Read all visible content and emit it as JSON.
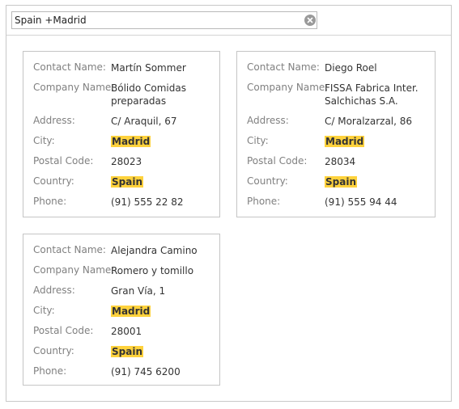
{
  "search": {
    "value": "Spain +Madrid"
  },
  "colors": {
    "highlight": "#ffd23c",
    "border": "#c5c5c5",
    "label": "#808080"
  },
  "labels": {
    "contact_name": "Contact Name:",
    "company_name": "Company Name:",
    "address": "Address:",
    "city": "City:",
    "postal_code": "Postal Code:",
    "country": "Country:",
    "phone": "Phone:"
  },
  "cards": [
    {
      "contact_name": "Martín Sommer",
      "company_line1": "Bólido Comidas",
      "company_line2": "preparadas",
      "address": "C/ Araquil, 67",
      "city": "Madrid",
      "postal_code": "28023",
      "country": "Spain",
      "phone": "(91) 555 22 82"
    },
    {
      "contact_name": "Diego Roel",
      "company_line1": "FISSA Fabrica Inter.",
      "company_line2": "Salchichas S.A.",
      "address": "C/ Moralzarzal, 86",
      "city": "Madrid",
      "postal_code": "28034",
      "country": "Spain",
      "phone": "(91) 555 94 44"
    },
    {
      "contact_name": "Alejandra Camino",
      "company_line1": "Romero y tomillo",
      "company_line2": "",
      "address": "Gran Vía, 1",
      "city": "Madrid",
      "postal_code": "28001",
      "country": "Spain",
      "phone": "(91) 745 6200"
    }
  ]
}
